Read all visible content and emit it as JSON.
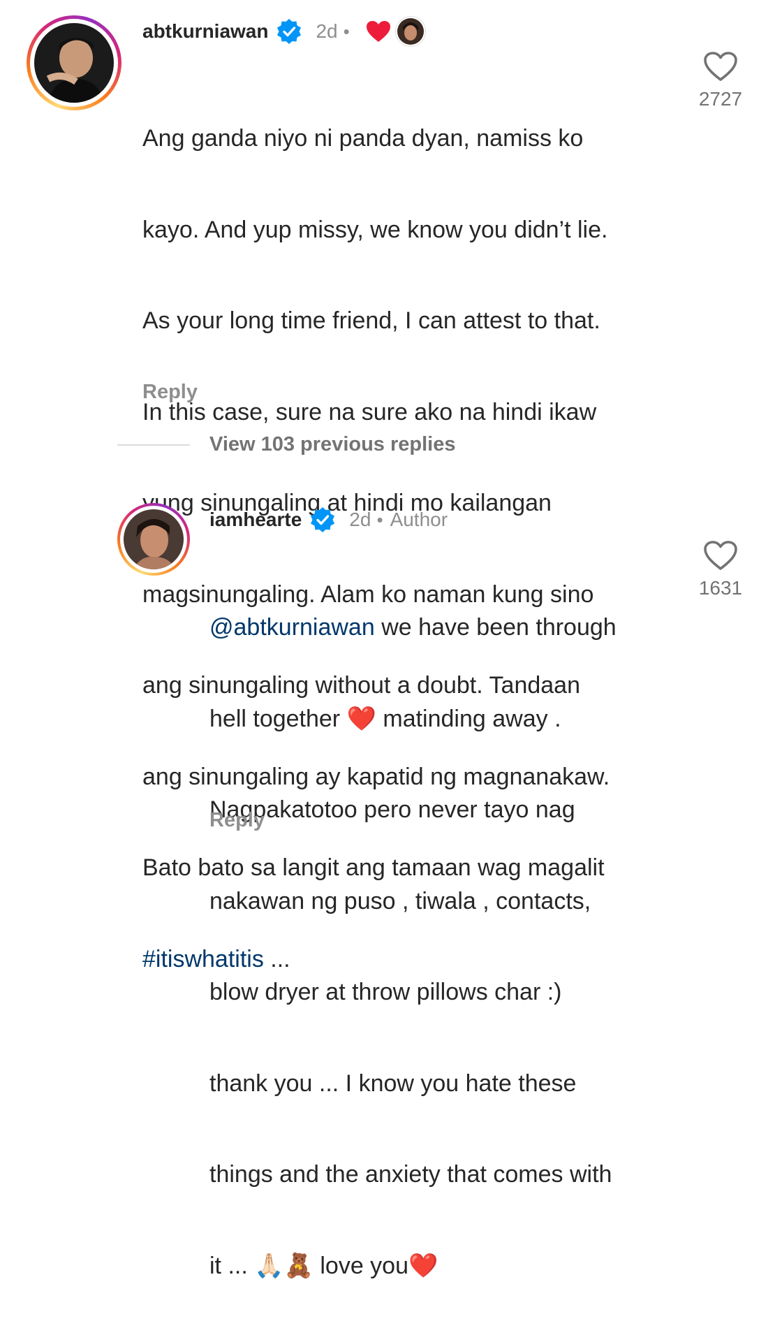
{
  "comments": [
    {
      "username": "abtkurniawan",
      "time": "2d",
      "dot": "•",
      "lines": [
        "Ang ganda niyo ni panda dyan, namiss ko",
        "kayo. And yup missy, we know you didn’t lie.",
        "As your long time friend, I can attest to that.",
        "In this case, sure na sure ako na hindi ikaw",
        "yung sinungaling at hindi mo kailangan",
        "magsinungaling. Alam ko naman kung sino",
        "ang sinungaling without a doubt. Tandaan",
        "ang sinungaling ay kapatid ng magnanakaw.",
        "Bato bato sa langit ang tamaan wag magalit"
      ],
      "hashtag": "#itiswhatitis",
      "ellipsis": " ...",
      "likes": "2727",
      "reply_label": "Reply"
    },
    {
      "username": "iamhearte",
      "time": "2d",
      "dot": "•",
      "author_label": "Author",
      "mention": "@abtkurniawan",
      "line1_rest": " we have been through",
      "line2a": "hell together ",
      "heart_emoji": "❤️",
      "line2b": " matinding away .",
      "lines": [
        "Nagpakatotoo pero never tayo nag",
        "nakawan ng puso , tiwala , contacts,",
        "blow dryer at throw pillows char :)",
        "thank you ... I know you hate these",
        "things and the anxiety that comes with"
      ],
      "last_line_a": "it ... ",
      "pray_emoji": "🙏🏻",
      "bear_emoji": "🧸",
      "last_line_b": " love you",
      "last_heart": "❤️",
      "likes": "1631",
      "reply_label": "Reply"
    }
  ],
  "view_replies_label": "View 103 previous replies",
  "colors": {
    "text": "#262626",
    "secondary": "#8e8e8e",
    "link": "#00376b",
    "verified": "#0095f6",
    "like_heart": "#ed4956"
  },
  "icons": [
    "verified-badge-icon",
    "heart-outline-icon",
    "liked-by-author-heart-icon"
  ]
}
